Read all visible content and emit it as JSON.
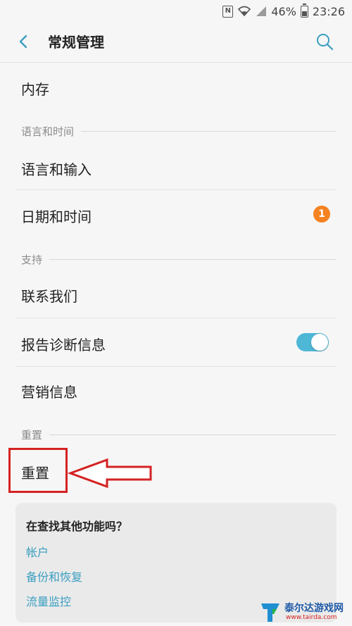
{
  "status_bar": {
    "nfc_icon": "N",
    "battery_percent": "46%",
    "battery_level": 0.46,
    "time": "23:26"
  },
  "header": {
    "title": "常规管理",
    "back_icon": "chevron-left-icon",
    "search_icon": "search-icon"
  },
  "items": {
    "storage": "内存",
    "section_language": "语言和时间",
    "language_input": "语言和输入",
    "date_time": "日期和时间",
    "date_time_badge": "1",
    "section_support": "支持",
    "contact_us": "联系我们",
    "report_diagnostics": "报告诊断信息",
    "report_diagnostics_toggle": true,
    "marketing_info": "营销信息",
    "section_reset": "重置",
    "reset": "重置"
  },
  "suggestions": {
    "title": "在查找其他功能吗？",
    "links": [
      "帐户",
      "备份和恢复",
      "流量监控"
    ]
  },
  "watermark": {
    "name": "泰尔达游戏网",
    "url": "www.tairda.com"
  },
  "colors": {
    "accent": "#4fb7d6",
    "badge": "#f58220",
    "link": "#3a9ec0",
    "annotation": "#d42222"
  }
}
